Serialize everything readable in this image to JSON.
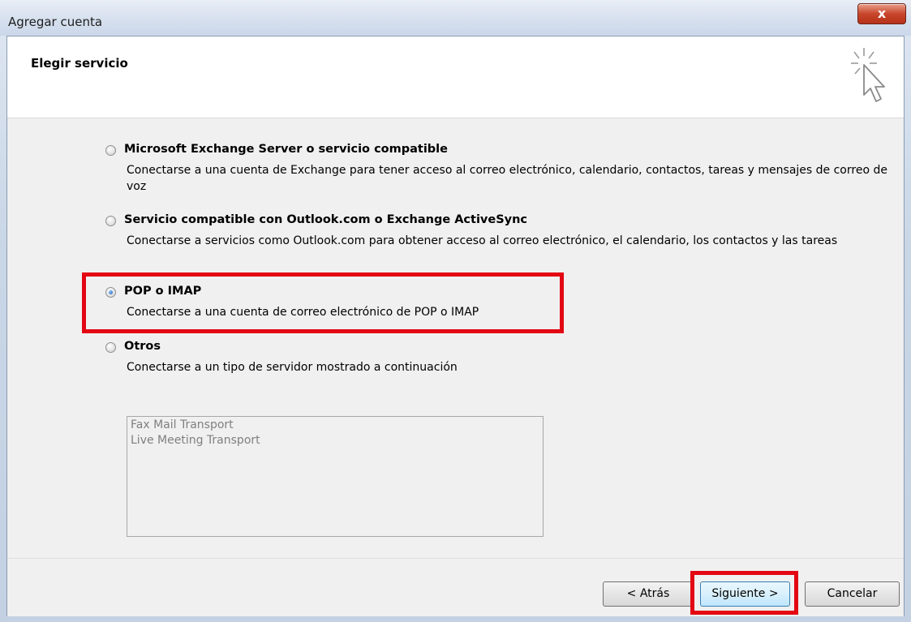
{
  "window": {
    "title": "Agregar cuenta",
    "close_label": "x"
  },
  "header": {
    "title": "Elegir servicio",
    "icon": "cursor-sparkle-icon"
  },
  "options": [
    {
      "label": "Microsoft Exchange Server o servicio compatible",
      "description": "Conectarse a una cuenta de Exchange para tener acceso al correo electrónico, calendario, contactos, tareas y mensajes de correo de voz",
      "checked": false
    },
    {
      "label": "Servicio compatible con Outlook.com o Exchange ActiveSync",
      "description": "Conectarse a servicios como Outlook.com para obtener acceso al correo electrónico, el calendario, los contactos y las tareas",
      "checked": false
    },
    {
      "label": "POP o IMAP",
      "description": "Conectarse a una cuenta de correo electrónico de POP o IMAP",
      "checked": true
    },
    {
      "label": "Otros",
      "description": "Conectarse a un tipo de servidor mostrado a continuación",
      "checked": false
    }
  ],
  "transports": [
    "Fax Mail Transport",
    "Live Meeting Transport"
  ],
  "buttons": {
    "back": "< Atrás",
    "next": "Siguiente >",
    "cancel": "Cancelar"
  },
  "colors": {
    "highlight": "#e30613",
    "primary_button_border": "#3c7fb1"
  }
}
